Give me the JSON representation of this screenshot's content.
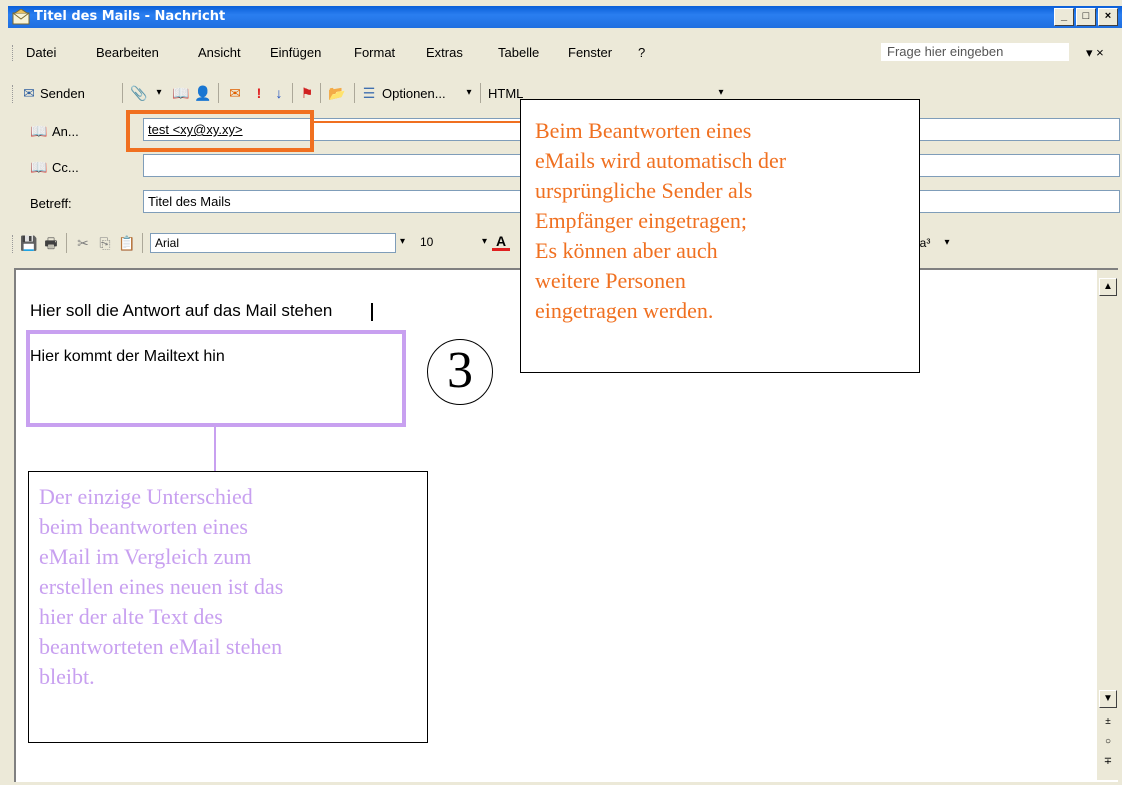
{
  "window": {
    "title": "Titel des Mails - Nachricht",
    "buttons": {
      "minimize": "_",
      "maximize": "□",
      "close": "×"
    }
  },
  "menubar": {
    "items": [
      "Datei",
      "Bearbeiten",
      "Ansicht",
      "Einfügen",
      "Format",
      "Extras",
      "Tabelle",
      "Fenster",
      "?"
    ],
    "help_placeholder": "Frage hier eingeben",
    "close_symbol": "×"
  },
  "toolbar": {
    "send_label": "Senden",
    "options_label": "Optionen...",
    "format_value": "HTML"
  },
  "header": {
    "to_label": "An...",
    "to_value": "test <xy@xy.xy>",
    "cc_label": "Cc...",
    "cc_value": "",
    "subject_label": "Betreff:",
    "subject_value": "Titel des Mails"
  },
  "format_toolbar": {
    "font": "Arial",
    "size": "10"
  },
  "body": {
    "line1": "Hier soll die Antwort auf das Mail stehen",
    "line2": "Hier kommt der Mailtext hin"
  },
  "annotations": {
    "callout_recipient": [
      "Beim Beantworten eines",
      "eMails wird automatisch der",
      "ursprüngliche Sender als",
      "Empfänger eingetragen;",
      "Es können aber auch",
      "weitere Personen",
      "eingetragen werden."
    ],
    "callout_body": [
      "Der einzige Unterschied",
      "beim beantworten eines",
      "eMail im Vergleich zum",
      "erstellen eines neuen ist das",
      "hier der alte Text des",
      "beantworteten eMail stehen",
      "bleibt."
    ],
    "step_number": "3"
  },
  "colors": {
    "titlebar": "#1f6fe0",
    "orange_accent": "#f07020",
    "violet_accent": "#c8a0f0"
  }
}
